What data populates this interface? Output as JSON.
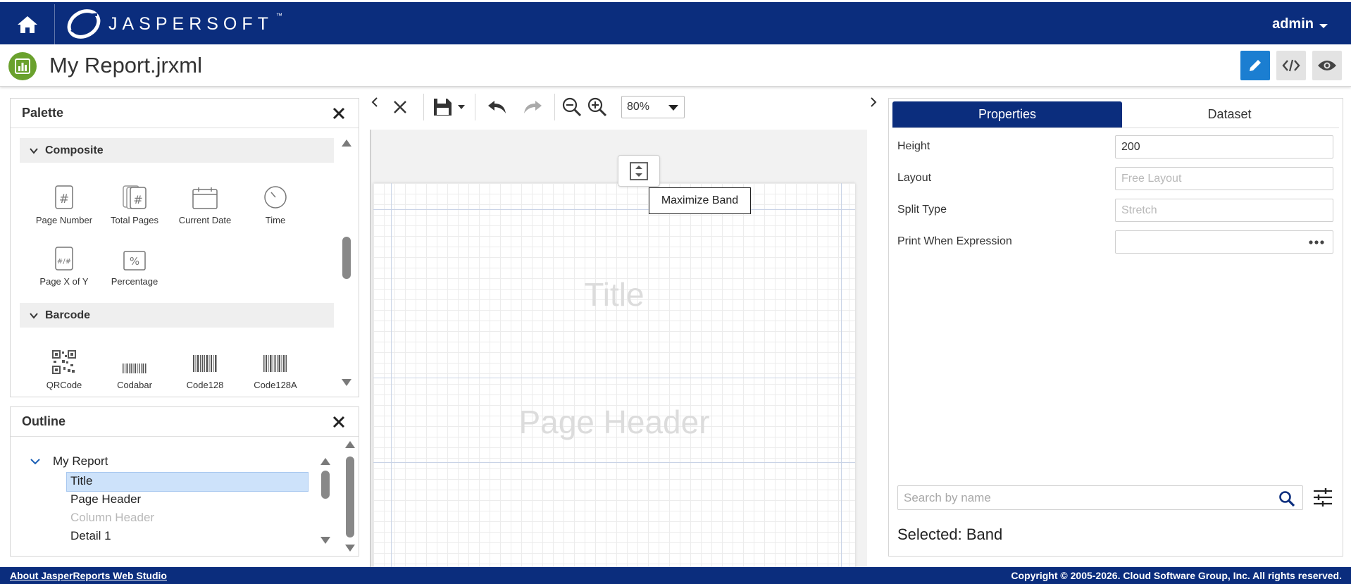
{
  "header": {
    "brand": "JASPERSOFT",
    "brand_tm": "™",
    "user": "admin"
  },
  "titlebar": {
    "title": "My Report.jrxml"
  },
  "palette": {
    "title": "Palette",
    "groups": [
      {
        "label": "Composite",
        "items": [
          "Page Number",
          "Total Pages",
          "Current Date",
          "Time",
          "Page X of Y",
          "Percentage"
        ]
      },
      {
        "label": "Barcode",
        "items": [
          "QRCode",
          "Codabar",
          "Code128",
          "Code128A"
        ]
      }
    ]
  },
  "outline": {
    "title": "Outline",
    "root": "My Report",
    "items": [
      "Title",
      "Page Header",
      "Column Header",
      "Detail 1"
    ]
  },
  "toolbar": {
    "zoom": "80%"
  },
  "canvas": {
    "bands": [
      "Title",
      "Page Header"
    ],
    "tooltip": "Maximize Band"
  },
  "properties": {
    "tabs": [
      "Properties",
      "Dataset"
    ],
    "rows": [
      {
        "label": "Height",
        "value": "200",
        "placeholder": ""
      },
      {
        "label": "Layout",
        "value": "",
        "placeholder": "Free Layout"
      },
      {
        "label": "Split Type",
        "value": "",
        "placeholder": "Stretch"
      },
      {
        "label": "Print When Expression",
        "value": "",
        "placeholder": ""
      }
    ],
    "search_placeholder": "Search by name",
    "selected": "Selected: Band"
  },
  "footer": {
    "about": "About JasperReports Web Studio",
    "copyright": "Copyright © 2005-2026. Cloud Software Group, Inc. All rights reserved."
  },
  "colors": {
    "brand_blue": "#0b2d7d",
    "accent_blue": "#1b7ed1",
    "report_icon_green": "#6aa12d"
  }
}
